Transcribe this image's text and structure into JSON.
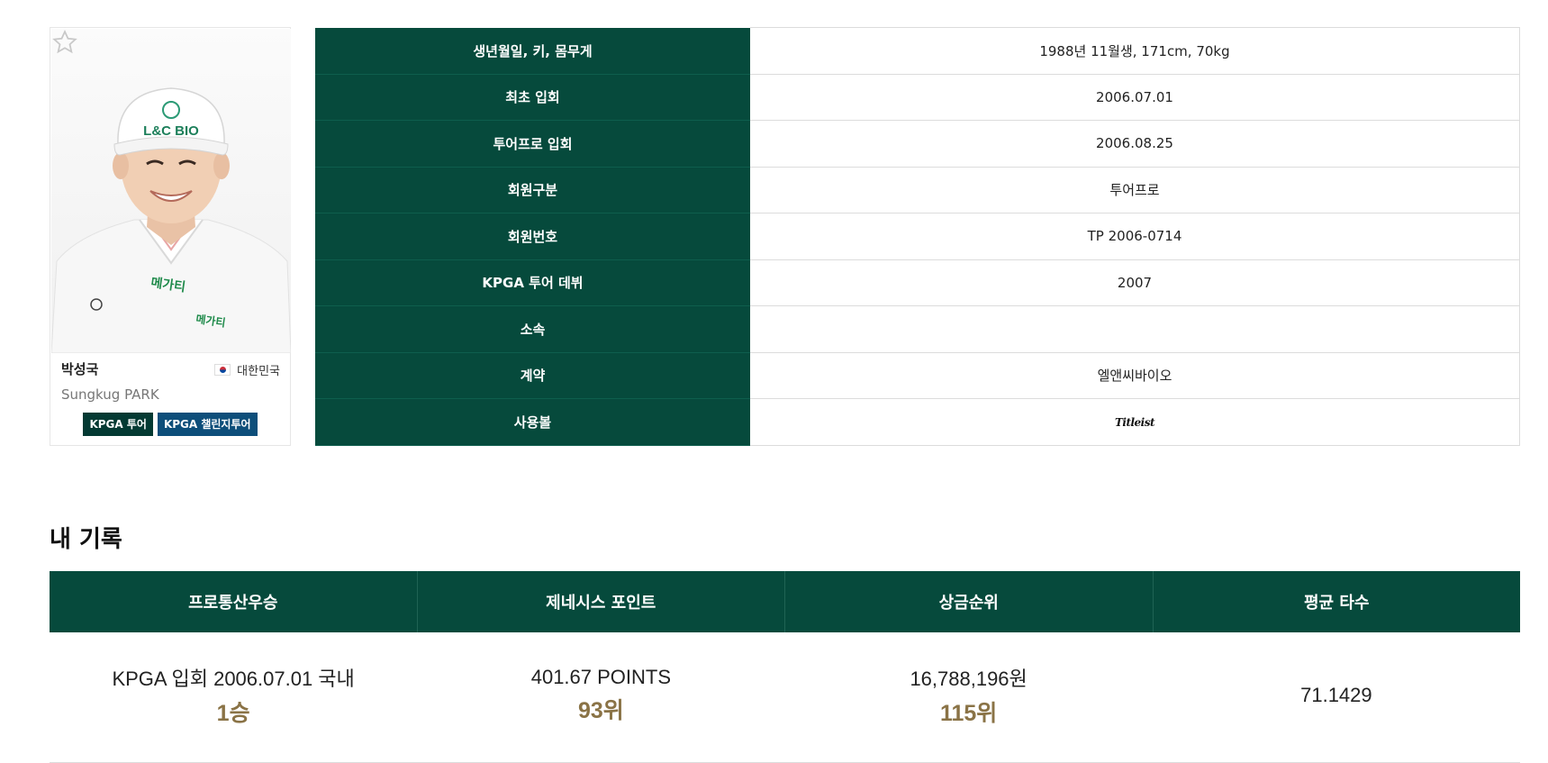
{
  "player": {
    "name": "박성국",
    "en_name": "Sungkug PARK",
    "country": "대한민국",
    "tags": [
      "KPGA 투어",
      "KPGA 챌린지투어"
    ],
    "cap_logo": "L&C BIO",
    "sponsor_text": "메가티"
  },
  "info": [
    {
      "label": "생년월일, 키, 몸무게",
      "value": "1988년 11월생, 171cm, 70kg"
    },
    {
      "label": "최초 입회",
      "value": "2006.07.01"
    },
    {
      "label": "투어프로 입회",
      "value": "2006.08.25"
    },
    {
      "label": "회원구분",
      "value": "투어프로"
    },
    {
      "label": "회원번호",
      "value": "TP 2006-0714"
    },
    {
      "label": "KPGA 투어 데뷔",
      "value": "2007"
    },
    {
      "label": "소속",
      "value": ""
    },
    {
      "label": "계약",
      "value": "엘앤씨바이오"
    },
    {
      "label": "사용볼",
      "value": "Titleist"
    }
  ],
  "records": {
    "title": "내 기록",
    "headers": [
      "프로통산우승",
      "제네시스 포인트",
      "상금순위",
      "평균 타수"
    ],
    "cells": [
      {
        "main": "KPGA 입회 2006.07.01 국내",
        "rank": "1승"
      },
      {
        "main": "401.67 POINTS",
        "rank": "93위"
      },
      {
        "main": "16,788,196원",
        "rank": "115위"
      },
      {
        "main": "71.1429",
        "rank": ""
      }
    ]
  },
  "colors": {
    "header_green": "#064a3c",
    "rank_gold": "#8a7346",
    "tag_dark": "#043a33",
    "tag_blue": "#0d4e7a"
  }
}
